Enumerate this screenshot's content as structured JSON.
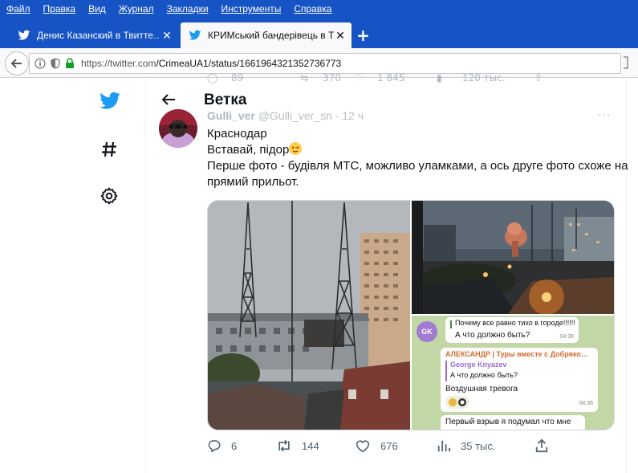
{
  "browser": {
    "menu": [
      "Файл",
      "Правка",
      "Вид",
      "Журнал",
      "Закладки",
      "Инструменты",
      "Справка"
    ],
    "tabs": [
      {
        "label": "Денис Казанский в Твитте…",
        "active": false
      },
      {
        "label": "КРИМський бандерівець в Т…",
        "active": true
      }
    ],
    "url_prefix": "https://twitter.com",
    "url_path": "/CrimeaUA1/status/1661964321352736773"
  },
  "previous_tweet_actions": {
    "replies": "89",
    "retweets": "370",
    "likes": "1 845",
    "views": "120 тыс."
  },
  "page": {
    "title": "Ветка"
  },
  "tweet": {
    "author_name": "Gulli_ver",
    "author_handle": "@Gulli_ver_sn",
    "time": "· 12 ч",
    "lines": [
      "Краснодар",
      "Вставай, підор",
      "Перше фото - будівля МТС, можливо уламками, а ось друге фото схоже на",
      "прямий прильот."
    ],
    "chat_preview": {
      "msg1": "Почему все равно тихо в городе!!!!!!",
      "msg1b": "А что должно быть?",
      "time1": "04:36",
      "avatar_initials": "GK",
      "sender": "АЛЕКСАНДР | Туры вместе с Добряко…",
      "quoted_name": "George Knyazev",
      "quoted_text": "А что должно быть?",
      "msg2": "Воздушная тревога",
      "time2": "04:36",
      "msg3": "Первый взрыв я подумал что мне"
    },
    "actions": {
      "replies": "6",
      "retweets": "144",
      "likes": "676",
      "views": "35 тыс."
    }
  },
  "colors": {
    "browser_chrome": "#1653c4",
    "twitter_blue": "#1d9bf0",
    "text": "#0f1419",
    "muted": "#536471"
  }
}
